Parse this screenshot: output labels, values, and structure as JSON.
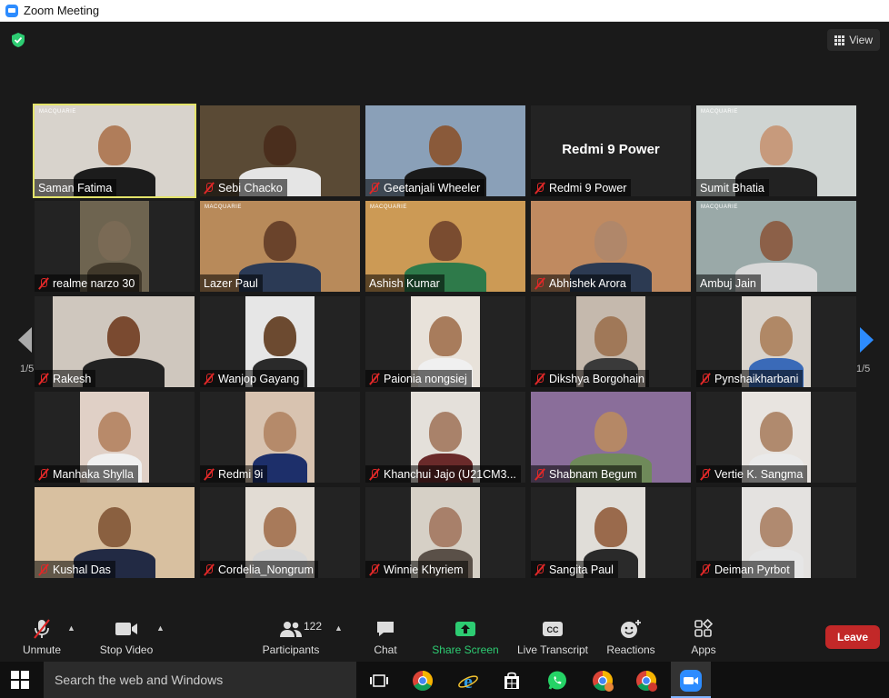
{
  "window": {
    "title": "Zoom Meeting"
  },
  "header": {
    "view_label": "View"
  },
  "pagination": {
    "left": "1/5",
    "right": "1/5"
  },
  "participants": [
    {
      "name": "Saman Fatima",
      "muted": false,
      "active": true,
      "brand": "MACQUARIE",
      "bg": "#d8d3cc",
      "skin": "#b07d5a",
      "shirt": "#1c1c1c",
      "vx": 0,
      "vw": 176
    },
    {
      "name": "Sebi Chacko",
      "muted": true,
      "bg": "#5a4a35",
      "skin": "#4a2e1d",
      "shirt": "#e5e5e5",
      "vx": 0,
      "vw": 176
    },
    {
      "name": "Geetanjali Wheeler",
      "muted": true,
      "bg": "#8aa0b8",
      "skin": "#8a5a3a",
      "shirt": "#1a1a1a",
      "vx": 0,
      "vw": 176
    },
    {
      "name": "Redmi 9 Power",
      "muted": true,
      "device": "Redmi 9 Power"
    },
    {
      "name": "Sumit Bhatia",
      "muted": false,
      "brand": "MACQUARIE",
      "bg": "#cfd4d2",
      "skin": "#c79a7c",
      "shirt": "#222",
      "vx": 0,
      "vw": 176
    },
    {
      "name": "realme narzo 30",
      "muted": true,
      "bg": "#6e6450",
      "skin": "#7a6a55",
      "shirt": "#40382a",
      "vx": 50,
      "vw": 76
    },
    {
      "name": "Lazer Paul",
      "muted": false,
      "brand": "MACQUARIE",
      "bg": "#b88a5a",
      "skin": "#6a432b",
      "shirt": "#2b3a55",
      "vx": 0,
      "vw": 176
    },
    {
      "name": "Ashish Kumar",
      "muted": false,
      "brand": "MACQUARIE",
      "bg": "#cc9a55",
      "skin": "#7a4c30",
      "shirt": "#2e7a4a",
      "vx": 0,
      "vw": 176
    },
    {
      "name": "Abhishek Arora",
      "muted": true,
      "bg": "#c08a60",
      "skin": "#b0876a",
      "shirt": "#2c3a52",
      "vx": 0,
      "vw": 176
    },
    {
      "name": "Ambuj Jain",
      "muted": false,
      "brand": "MACQUARIE",
      "bg": "#9aa9a8",
      "skin": "#8c6048",
      "shirt": "#d8d8d8",
      "vx": 0,
      "vw": 176
    },
    {
      "name": "Rakesh",
      "muted": true,
      "bg": "#cfc7be",
      "skin": "#7a4a30",
      "shirt": "#222",
      "vx": 20,
      "vw": 156
    },
    {
      "name": "Wanjop Gayang",
      "muted": true,
      "bg": "#e6e6e6",
      "skin": "#6c4a30",
      "shirt": "#2a2a2a",
      "vx": 50,
      "vw": 76
    },
    {
      "name": "Paionia nongsiej",
      "muted": true,
      "bg": "#e8e2da",
      "skin": "#a87c5c",
      "shirt": "#f0f0f0",
      "vx": 50,
      "vw": 76
    },
    {
      "name": "Dikshya Borgohain",
      "muted": true,
      "bg": "#c5b9ad",
      "skin": "#a07858",
      "shirt": "#3a3a3a",
      "vx": 50,
      "vw": 76
    },
    {
      "name": "Pynshaikharbani",
      "muted": true,
      "bg": "#d9d3cc",
      "skin": "#b08866",
      "shirt": "#3a6ab8",
      "vx": 50,
      "vw": 76
    },
    {
      "name": "Manhaka Shylla",
      "muted": true,
      "bg": "#e0d0c6",
      "skin": "#b88a6a",
      "shirt": "#f0f0f0",
      "vx": 50,
      "vw": 76
    },
    {
      "name": "Redmi 9i",
      "muted": true,
      "bg": "#d8c3b0",
      "skin": "#b58a6a",
      "shirt": "#1d2f6a",
      "vx": 50,
      "vw": 76
    },
    {
      "name": "Khanchui Jajo (U21CM3...",
      "muted": true,
      "bg": "#e4e0da",
      "skin": "#a9826a",
      "shirt": "#6a2a2a",
      "vx": 50,
      "vw": 76
    },
    {
      "name": "Shabnam Begum",
      "muted": true,
      "bg": "#8a6e9a",
      "skin": "#b58866",
      "shirt": "#6f8a5a",
      "vx": 0,
      "vw": 176
    },
    {
      "name": "Vertie K. Sangma",
      "muted": true,
      "bg": "#e8e4e0",
      "skin": "#b08a6e",
      "shirt": "#eaeaea",
      "vx": 50,
      "vw": 76
    },
    {
      "name": "Kushal Das",
      "muted": true,
      "bg": "#d8c0a0",
      "skin": "#8a6040",
      "shirt": "#222a44",
      "vx": 0,
      "vw": 176
    },
    {
      "name": "Cordelia_Nongrum",
      "muted": true,
      "bg": "#e2dcd4",
      "skin": "#a87a5a",
      "shirt": "#d8d8d8",
      "vx": 50,
      "vw": 76
    },
    {
      "name": "Winnie Khyriem",
      "muted": true,
      "bg": "#d6d0c6",
      "skin": "#a8806a",
      "shirt": "#5a5048",
      "vx": 50,
      "vw": 76
    },
    {
      "name": "Sangita Paul",
      "muted": true,
      "bg": "#e0ddd8",
      "skin": "#9a6a4c",
      "shirt": "#2a2a2a",
      "vx": 50,
      "vw": 76
    },
    {
      "name": "Deiman Pyrbot",
      "muted": true,
      "bg": "#e4e2e0",
      "skin": "#b08a70",
      "shirt": "#e6e6e6",
      "vx": 50,
      "vw": 76
    }
  ],
  "toolbar": {
    "unmute": "Unmute",
    "stop_video": "Stop Video",
    "participants": "Participants",
    "participants_count": "122",
    "chat": "Chat",
    "share_screen": "Share Screen",
    "live_transcript": "Live Transcript",
    "reactions": "Reactions",
    "apps": "Apps",
    "leave": "Leave"
  },
  "taskbar": {
    "search_placeholder": "Search the web and Windows"
  },
  "colors": {
    "accent": "#2d8cff",
    "share": "#2dcc72",
    "leave": "#c22828",
    "active_speaker": "#e3e36a"
  }
}
